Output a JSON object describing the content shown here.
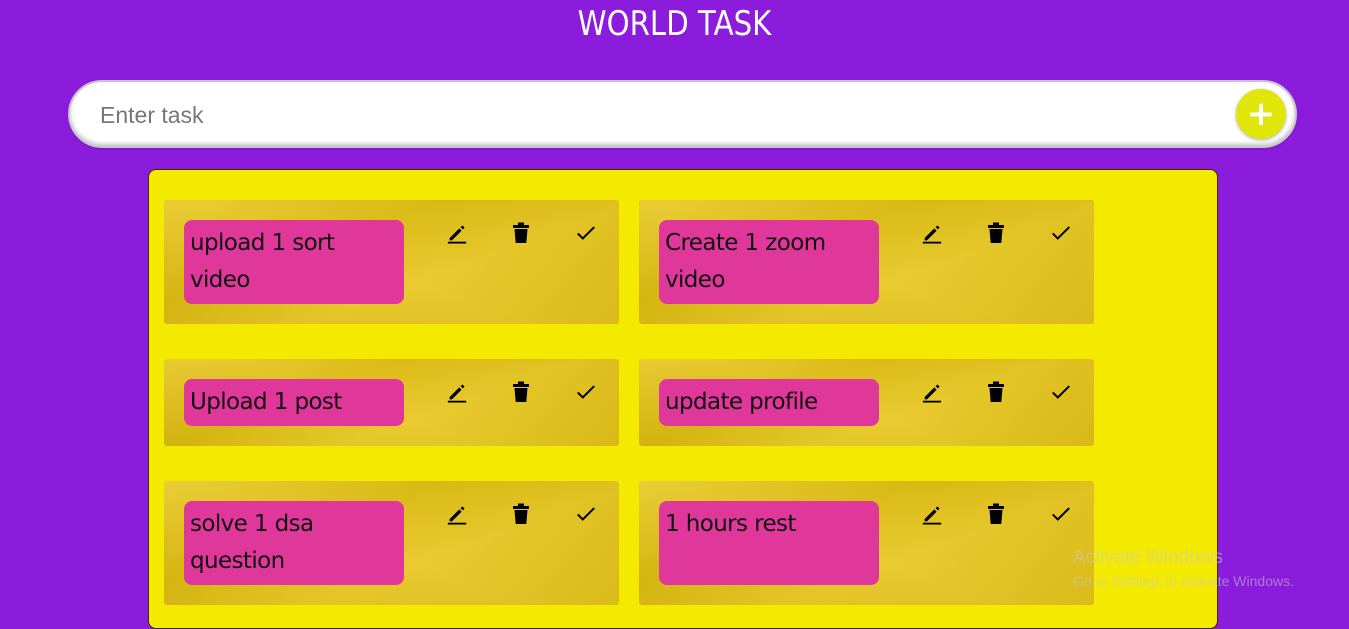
{
  "app": {
    "title": "WORLD TASK"
  },
  "input": {
    "placeholder": "Enter task",
    "value": "",
    "add_label": "+"
  },
  "tasks": [
    {
      "text": "upload 1 sort video"
    },
    {
      "text": "Create 1 zoom video"
    },
    {
      "text": "Upload 1 post"
    },
    {
      "text": "update profile"
    },
    {
      "text": "solve 1 dsa question"
    },
    {
      "text": "1 hours rest"
    }
  ],
  "task_actions": [
    "edit-icon",
    "trash-icon",
    "check-icon"
  ],
  "watermark": {
    "title": "Activate Windows",
    "subtitle": "Go to Settings to activate Windows."
  },
  "colors": {
    "background": "#8b1cdb",
    "board": "#f3ea00",
    "card": "#e6c30f",
    "note": "#e0379a",
    "add_button": "#e0e60a"
  }
}
